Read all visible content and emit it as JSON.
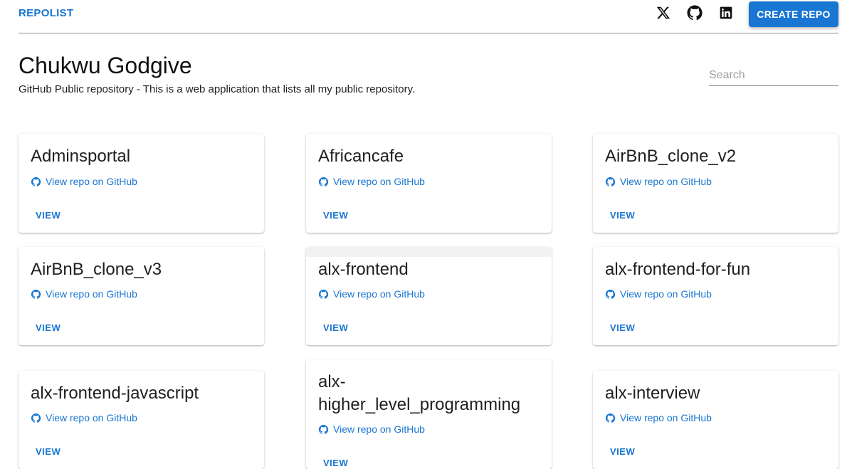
{
  "nav": {
    "brand": "REPOLIST",
    "social_icons": [
      "x-icon",
      "github-icon",
      "linkedin-icon"
    ],
    "create_button": "CREATE REPO"
  },
  "header": {
    "title": "Chukwu Godgive",
    "subtitle": "GitHub Public repository - This is a web application that lists all my public repository."
  },
  "search": {
    "placeholder": "Search"
  },
  "colors": {
    "accent": "#1976d2",
    "divider": "#8a8a8a"
  },
  "repos": [
    {
      "title": "Adminsportal",
      "link_label": "View repo on GitHub",
      "action": "VIEW"
    },
    {
      "title": "Africancafe",
      "link_label": "View repo on GitHub",
      "action": "VIEW"
    },
    {
      "title": "AirBnB_clone_v2",
      "link_label": "View repo on GitHub",
      "action": "VIEW"
    },
    {
      "title": "AirBnB_clone_v3",
      "link_label": "View repo on GitHub",
      "action": "VIEW"
    },
    {
      "title": "alx-frontend",
      "link_label": "View repo on GitHub",
      "action": "VIEW"
    },
    {
      "title": "alx-frontend-for-fun",
      "link_label": "View repo on GitHub",
      "action": "VIEW"
    },
    {
      "title": "alx-frontend-javascript",
      "link_label": "View repo on GitHub",
      "action": "VIEW"
    },
    {
      "title_line1": "alx-",
      "title_line2": "higher_level_programming",
      "link_label": "View repo on GitHub",
      "action": "VIEW"
    },
    {
      "title": "alx-interview",
      "link_label": "View repo on GitHub",
      "action": "VIEW"
    }
  ]
}
